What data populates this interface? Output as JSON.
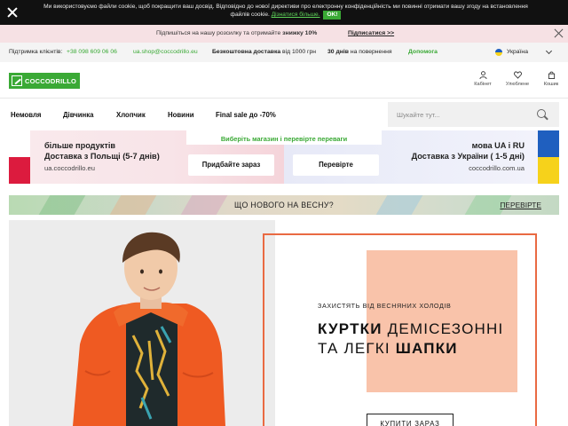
{
  "cookie_bar": {
    "text_line1": "Ми використовуємо файли cookie, щоб покращити ваш досвід. Відповідно до нової директиви про електронну конфіденційність ми повинні отримати вашу згоду на встановлення",
    "text_line2": "файлів cookie.",
    "learn_more": "Дізнатися більше.",
    "ok_label": "OK!"
  },
  "promo": {
    "text": "Підпишіться на нашу розсилку та отримайте",
    "discount": "знижку 10%",
    "subscribe_label": "Підписатися >>"
  },
  "info_bar": {
    "support_label": "Підтримка клієнтів:",
    "phone": "+38 098 609 06 06",
    "email": "ua.shop@coccodrillo.eu",
    "free_delivery_bold": "Безкоштовна доставка",
    "free_delivery_rest": "від 1000 грн",
    "return_bold": "30 днів",
    "return_rest": "на повернення",
    "help_label": "Допомога",
    "language": "Україна"
  },
  "header": {
    "logo_text": "COCCODRILLO",
    "cabinet_label": "Кабінет",
    "favorites_label": "Улюблене",
    "cart_label": "Кошик"
  },
  "nav": {
    "items": [
      "Немовля",
      "Дівчинка",
      "Хлопчик",
      "Новини",
      "Final sale до -70%"
    ],
    "search_placeholder": "Шукайте тут..."
  },
  "store_banner": {
    "title": "Виберіть магазин і перевірте переваги",
    "left_line1": "більше продуктів",
    "left_line2": "Доставка з Польщі (5-7 днів)",
    "left_url": "ua.coccodrillo.eu",
    "left_button": "Придбайте зараз",
    "right_line1": "мова UA і RU",
    "right_line2": "Доставка з України ( 1-5 дні)",
    "right_url": "coccodrillo.com.ua",
    "right_button": "Перевірте"
  },
  "spring_banner": {
    "title": "ЩО НОВОГО НА ВЕСНУ?",
    "link": "ПЕРЕВІРТЕ"
  },
  "hero": {
    "subtitle": "ЗАХИСТЯТЬ ВІД ВЕСНЯНИХ ХОЛОДІВ",
    "line1_bold": "КУРТКИ",
    "line1_rest": "ДЕМІСЕЗОННІ",
    "line2_rest": "ТА ЛЕГКІ",
    "line2_bold": "ШАПКИ",
    "button": "КУПИТИ ЗАРАЗ"
  },
  "colors": {
    "brand_green": "#3aa935",
    "sale_red": "#d81b3b",
    "hero_frame": "#e96a42",
    "hero_peach": "#f9c3aa"
  }
}
